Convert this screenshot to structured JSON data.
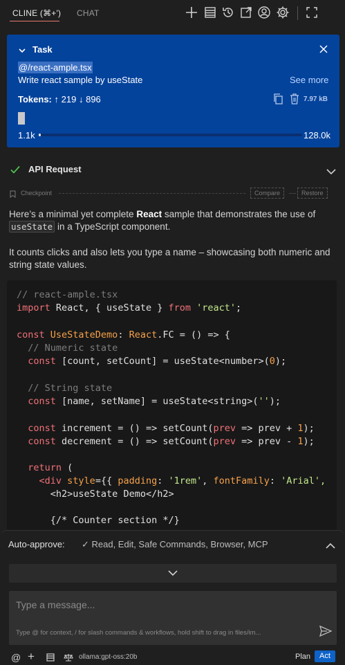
{
  "tabs": [
    {
      "label": "CLINE (⌘+')"
    },
    {
      "label": "CHAT"
    }
  ],
  "toolbar_icons": [
    "plus-icon",
    "server-icon",
    "history-icon",
    "popout-icon",
    "account-icon",
    "gear-icon",
    "fullscreen-icon"
  ],
  "task": {
    "title": "Task",
    "file_mention": "@/react-ample.tsx",
    "description": "Write react sample by useState",
    "see_more": "See more",
    "tokens_label": "Tokens:",
    "tokens_in": "219",
    "tokens_out": "896",
    "size": "7.97 kB",
    "context_used": "1.1k",
    "context_max": "128.0k",
    "context_fraction": 0.009
  },
  "api_request": {
    "title": "API Request",
    "checkpoint_label": "Checkpoint",
    "compare_label": "Compare",
    "restore_label": "Restore"
  },
  "message": {
    "p1_before": "Here’s a minimal yet complete ",
    "p1_bold": "React",
    "p1_after": " sample that demonstrates the use of",
    "p1_code": "useState",
    "p1_end": " in a TypeScript component.",
    "p2": "It counts clicks and also lets you type a name – showcasing both numeric and string state values."
  },
  "code": {
    "line01": "// react-ample.tsx",
    "line02_kw": "import",
    "line02_rest": " React, { useState } ",
    "line02_from": "from",
    "line02_str": "'react'",
    "line02_end": ";",
    "line04_kw": "const",
    "line04_name": "UseStateDemo",
    "line04_colon": ": ",
    "line04_type": "React",
    "line04_rest": ".FC = () => {",
    "line05": "  // Numeric state",
    "line06_kw": "const",
    "line06_rest": " [count, setCount] = useState<number>(",
    "line06_num": "0",
    "line06_end": ");",
    "line08": "  // String state",
    "line09_kw": "const",
    "line09_rest": " [name, setName] = useState<string>(",
    "line09_str": "''",
    "line09_end": ");",
    "line11_kw": "const",
    "line11_rest": " increment = () => setCount(",
    "line11_prev": "prev",
    "line11_mid": " => prev + ",
    "line11_num": "1",
    "line11_end": ");",
    "line12_kw": "const",
    "line12_rest": " decrement = () => setCount(",
    "line12_prev": "prev",
    "line12_mid": " => prev - ",
    "line12_num": "1",
    "line12_end": ");",
    "line14_kw": "return",
    "line14_rest": " (",
    "line15_tag": "<div",
    "line15_attr": " style",
    "line15_eq": "={{ ",
    "line15_p1": "padding",
    "line15_c1": ": ",
    "line15_s1": "'1rem'",
    "line15_c2": ", ",
    "line15_p2": "fontFamily",
    "line15_c3": ": ",
    "line15_s2": "'Arial',",
    "line16": "<h2>useState Demo</h2>",
    "line18": "{/* Counter section */}"
  },
  "auto_approve": {
    "label": "Auto-approve:",
    "value": "✓ Read, Edit, Safe Commands, Browser, MCP"
  },
  "input": {
    "placeholder": "Type a message...",
    "hint": "Type @ for context, / for slash commands & workflows, hold shift to drag in files/im..."
  },
  "bottom": {
    "at": "@",
    "plus": "+",
    "model": "ollama:gpt-oss:20b",
    "plan": "Plan",
    "act": "Act"
  },
  "colors": {
    "task_bg": "#04439c",
    "accent": "#0e63c8",
    "tab_underline": "#e8796f",
    "check": "#4fc14f"
  }
}
